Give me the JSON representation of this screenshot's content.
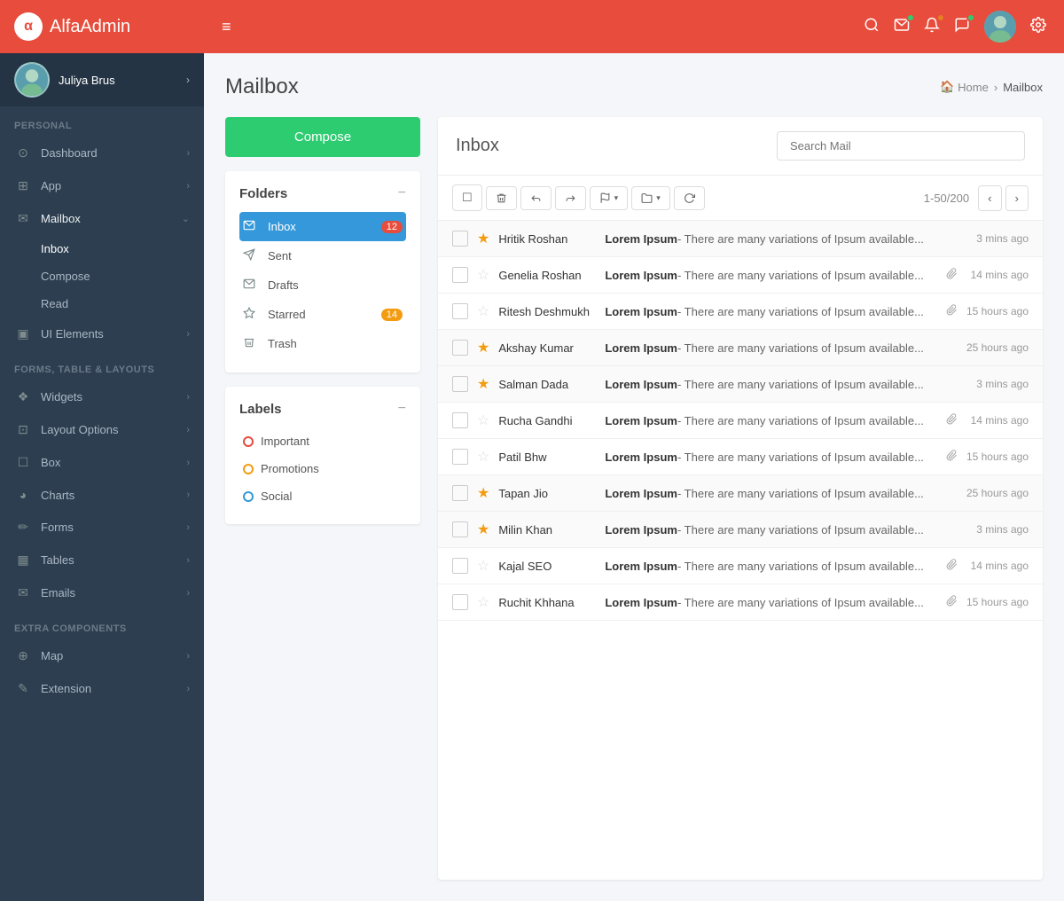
{
  "brand": {
    "logo_letter": "α",
    "name_bold": "Alfa",
    "name_light": "Admin"
  },
  "user": {
    "name": "Juliya Brus",
    "chevron": "›"
  },
  "sidebar": {
    "sections": [
      {
        "label": "PERSONAL",
        "items": [
          {
            "id": "dashboard",
            "icon": "⊙",
            "label": "Dashboard",
            "has_arrow": true
          },
          {
            "id": "app",
            "icon": "⊞",
            "label": "App",
            "has_arrow": true
          },
          {
            "id": "mailbox",
            "icon": "✉",
            "label": "Mailbox",
            "active": true,
            "has_arrow": false
          }
        ],
        "sub_items": [
          {
            "id": "inbox",
            "label": "Inbox",
            "active": true
          },
          {
            "id": "compose",
            "label": "Compose"
          },
          {
            "id": "read",
            "label": "Read"
          }
        ],
        "more_items": [
          {
            "id": "ui-elements",
            "icon": "▣",
            "label": "UI Elements",
            "has_arrow": true
          }
        ]
      }
    ],
    "sections2": [
      {
        "label": "FORMS, TABLE & LAYOUTS",
        "items": [
          {
            "id": "widgets",
            "icon": "❖",
            "label": "Widgets",
            "has_arrow": true
          },
          {
            "id": "layout-options",
            "icon": "⊡",
            "label": "Layout Options",
            "has_arrow": true
          },
          {
            "id": "box",
            "icon": "☐",
            "label": "Box",
            "has_arrow": true
          },
          {
            "id": "charts",
            "icon": "◕",
            "label": "Charts",
            "has_arrow": true
          },
          {
            "id": "forms",
            "icon": "✏",
            "label": "Forms",
            "has_arrow": true
          },
          {
            "id": "tables",
            "icon": "▦",
            "label": "Tables",
            "has_arrow": true
          },
          {
            "id": "emails",
            "icon": "✉",
            "label": "Emails",
            "has_arrow": true
          }
        ]
      }
    ],
    "sections3": [
      {
        "label": "EXTRA COMPONENTS",
        "items": [
          {
            "id": "map",
            "icon": "⊕",
            "label": "Map",
            "has_arrow": true
          },
          {
            "id": "extension",
            "icon": "✎",
            "label": "Extension",
            "has_arrow": true
          }
        ]
      }
    ]
  },
  "topbar": {
    "hamburger": "≡",
    "icons": {
      "search": "🔍",
      "mail": "✉",
      "bell": "🔔",
      "chat": "💬"
    }
  },
  "page": {
    "title": "Mailbox",
    "breadcrumb_home": "Home",
    "breadcrumb_current": "Mailbox"
  },
  "compose_btn": "Compose",
  "folders_title": "Folders",
  "folders": [
    {
      "id": "inbox",
      "icon": "✉",
      "label": "Inbox",
      "badge": "12",
      "active": true
    },
    {
      "id": "sent",
      "icon": "➤",
      "label": "Sent",
      "badge": null
    },
    {
      "id": "drafts",
      "icon": "✉",
      "label": "Drafts",
      "badge": null
    },
    {
      "id": "starred",
      "icon": "★",
      "label": "Starred",
      "badge": "14",
      "badge_yellow": true
    },
    {
      "id": "trash",
      "icon": "🗑",
      "label": "Trash",
      "badge": null
    }
  ],
  "labels_title": "Labels",
  "labels": [
    {
      "id": "important",
      "label": "Important",
      "color": "red"
    },
    {
      "id": "promotions",
      "label": "Promotions",
      "color": "yellow"
    },
    {
      "id": "social",
      "label": "Social",
      "color": "blue"
    }
  ],
  "inbox_title": "Inbox",
  "search_placeholder": "Search Mail",
  "toolbar": {
    "select_icon": "☐",
    "delete_icon": "🗑",
    "reply_icon": "↩",
    "forward_icon": "↪",
    "flag_icon": "⚑",
    "folder_icon": "📁",
    "refresh_icon": "↻",
    "pagination": "1-50/200",
    "prev": "‹",
    "next": "›"
  },
  "emails": [
    {
      "id": 1,
      "sender": "Hritik Roshan",
      "starred": true,
      "subject": "Lorem Ipsum",
      "preview": "- There are many variations of Ipsum available...",
      "attachment": false,
      "time": "3 mins ago",
      "read": false
    },
    {
      "id": 2,
      "sender": "Genelia Roshan",
      "starred": false,
      "subject": "Lorem Ipsum",
      "preview": "- There are many variations of Ipsum available...",
      "attachment": true,
      "time": "14 mins ago",
      "read": true
    },
    {
      "id": 3,
      "sender": "Ritesh Deshmukh",
      "starred": false,
      "subject": "Lorem Ipsum",
      "preview": "- There are many variations of Ipsum available...",
      "attachment": true,
      "time": "15 hours ago",
      "read": true
    },
    {
      "id": 4,
      "sender": "Akshay Kumar",
      "starred": true,
      "subject": "Lorem Ipsum",
      "preview": "- There are many variations of Ipsum available...",
      "attachment": false,
      "time": "25 hours ago",
      "read": false
    },
    {
      "id": 5,
      "sender": "Salman Dada",
      "starred": true,
      "subject": "Lorem Ipsum",
      "preview": "- There are many variations of Ipsum available...",
      "attachment": false,
      "time": "3 mins ago",
      "read": false
    },
    {
      "id": 6,
      "sender": "Rucha Gandhi",
      "starred": false,
      "subject": "Lorem Ipsum",
      "preview": "- There are many variations of Ipsum available...",
      "attachment": true,
      "time": "14 mins ago",
      "read": true
    },
    {
      "id": 7,
      "sender": "Patil Bhw",
      "starred": false,
      "subject": "Lorem Ipsum",
      "preview": "- There are many variations of Ipsum available...",
      "attachment": true,
      "time": "15 hours ago",
      "read": true
    },
    {
      "id": 8,
      "sender": "Tapan Jio",
      "starred": true,
      "subject": "Lorem Ipsum",
      "preview": "- There are many variations of Ipsum available...",
      "attachment": false,
      "time": "25 hours ago",
      "read": false
    },
    {
      "id": 9,
      "sender": "Milin Khan",
      "starred": true,
      "subject": "Lorem Ipsum",
      "preview": "- There are many variations of Ipsum available...",
      "attachment": false,
      "time": "3 mins ago",
      "read": false
    },
    {
      "id": 10,
      "sender": "Kajal SEO",
      "starred": false,
      "subject": "Lorem Ipsum",
      "preview": "- There are many variations of Ipsum available...",
      "attachment": true,
      "time": "14 mins ago",
      "read": true
    },
    {
      "id": 11,
      "sender": "Ruchit Khhana",
      "starred": false,
      "subject": "Lorem Ipsum",
      "preview": "- There are many variations of Ipsum available...",
      "attachment": true,
      "time": "15 hours ago",
      "read": true
    }
  ]
}
